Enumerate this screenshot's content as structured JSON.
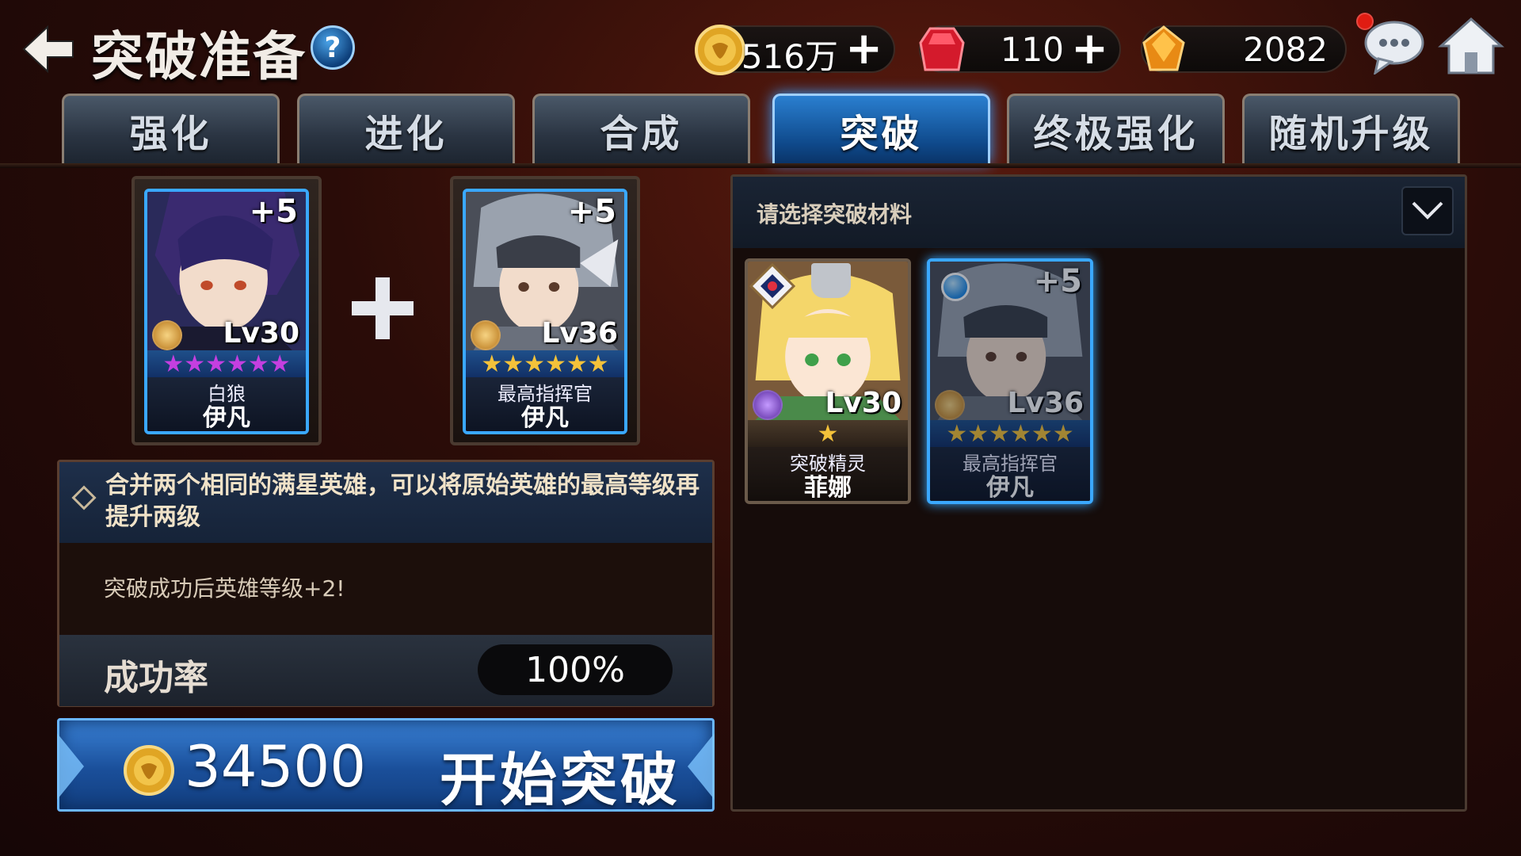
{
  "header": {
    "title": "突破准备",
    "help_label": "?"
  },
  "resources": {
    "gold": "516万",
    "gems": "110",
    "crystals": "2082",
    "plus": "+"
  },
  "tabs": [
    {
      "label": "强化"
    },
    {
      "label": "进化"
    },
    {
      "label": "合成"
    },
    {
      "label": "突破"
    },
    {
      "label": "终极强化"
    },
    {
      "label": "随机升级"
    }
  ],
  "active_tab": "突破",
  "heroes": [
    {
      "plus": "+5",
      "level": "Lv30",
      "title": "白狼",
      "name": "伊凡",
      "stars": "★★★★★★",
      "star_color": "#c43fe0"
    },
    {
      "plus": "+5",
      "level": "Lv36",
      "title": "最高指挥官",
      "name": "伊凡",
      "stars": "★★★★★★",
      "star_color": "#f4c23a"
    }
  ],
  "info": {
    "description": "合并两个相同的满星英雄，可以将原始英雄的最高等级再提升两级",
    "note": "突破成功后英雄等级+2!",
    "rate_label": "成功率",
    "rate_value": "100%"
  },
  "start": {
    "cost": "34500",
    "label": "开始突破"
  },
  "materials": {
    "title": "请选择突破材料",
    "items": [
      {
        "level": "Lv30",
        "title": "突破精灵",
        "name": "菲娜",
        "stars": "★",
        "locked": true
      },
      {
        "plus": "+5",
        "level": "Lv36",
        "title": "最高指挥官",
        "name": "伊凡",
        "stars": "★★★★★★",
        "selected": true
      }
    ]
  },
  "colors": {
    "accent": "#3aa8ff",
    "background": "#2a0c08",
    "star_gold": "#f4c23a",
    "star_purple": "#c43fe0"
  }
}
